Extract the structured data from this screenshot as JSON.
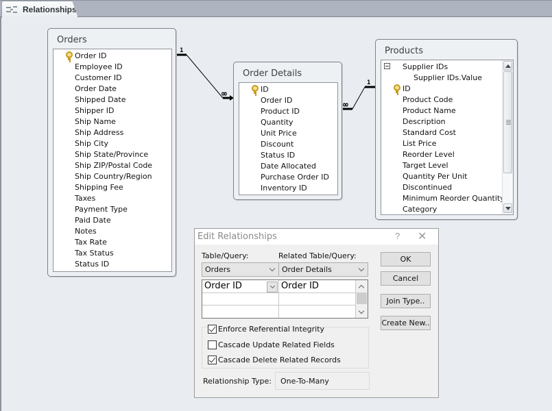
{
  "document_tab": {
    "label": "Relationships",
    "icon": "relationships-icon"
  },
  "tables": {
    "orders": {
      "title": "Orders",
      "fields": [
        "Order ID",
        "Employee ID",
        "Customer ID",
        "Order Date",
        "Shipped Date",
        "Shipper ID",
        "Ship Name",
        "Ship Address",
        "Ship City",
        "Ship State/Province",
        "Ship ZIP/Postal Code",
        "Ship Country/Region",
        "Shipping Fee",
        "Taxes",
        "Payment Type",
        "Paid Date",
        "Notes",
        "Tax Rate",
        "Tax Status",
        "Status ID"
      ],
      "primary_key": "Order ID"
    },
    "order_details": {
      "title": "Order Details",
      "fields": [
        "ID",
        "Order ID",
        "Product ID",
        "Quantity",
        "Unit Price",
        "Discount",
        "Status ID",
        "Date Allocated",
        "Purchase Order ID",
        "Inventory ID"
      ],
      "primary_key": "ID"
    },
    "products": {
      "title": "Products",
      "fields": [
        "Supplier IDs",
        "Supplier IDs.Value",
        "ID",
        "Product Code",
        "Product Name",
        "Description",
        "Standard Cost",
        "List Price",
        "Reorder Level",
        "Target Level",
        "Quantity Per Unit",
        "Discontinued",
        "Minimum Reorder Quantity",
        "Category"
      ],
      "primary_key": "ID",
      "expanded_field": "Supplier IDs"
    }
  },
  "relationships": [
    {
      "from": "Orders.Order ID",
      "to": "Order Details.Order ID",
      "one_label": "1",
      "many_label": "∞"
    },
    {
      "from": "Products.ID",
      "to": "Order Details.Product ID",
      "one_label": "1",
      "many_label": "∞"
    }
  ],
  "dialog": {
    "title": "Edit Relationships",
    "help_label": "?",
    "close_label": "✕",
    "table_query_label": "Table/Query:",
    "related_table_query_label": "Related Table/Query:",
    "table_query_value": "Orders",
    "related_table_query_value": "Order Details",
    "field_rows": [
      {
        "left": "Order ID",
        "right": "Order ID"
      },
      {
        "left": "",
        "right": ""
      },
      {
        "left": "",
        "right": ""
      }
    ],
    "buttons": {
      "ok": "OK",
      "cancel": "Cancel",
      "join_type": "Join Type..",
      "create_new": "Create New.."
    },
    "options": {
      "enforce_integrity": {
        "label": "Enforce Referential Integrity",
        "checked": true
      },
      "cascade_update": {
        "label": "Cascade Update Related Fields",
        "checked": false
      },
      "cascade_delete": {
        "label": "Cascade Delete Related Records",
        "checked": true
      }
    },
    "relationship_type_label": "Relationship Type:",
    "relationship_type_value": "One-To-Many"
  }
}
